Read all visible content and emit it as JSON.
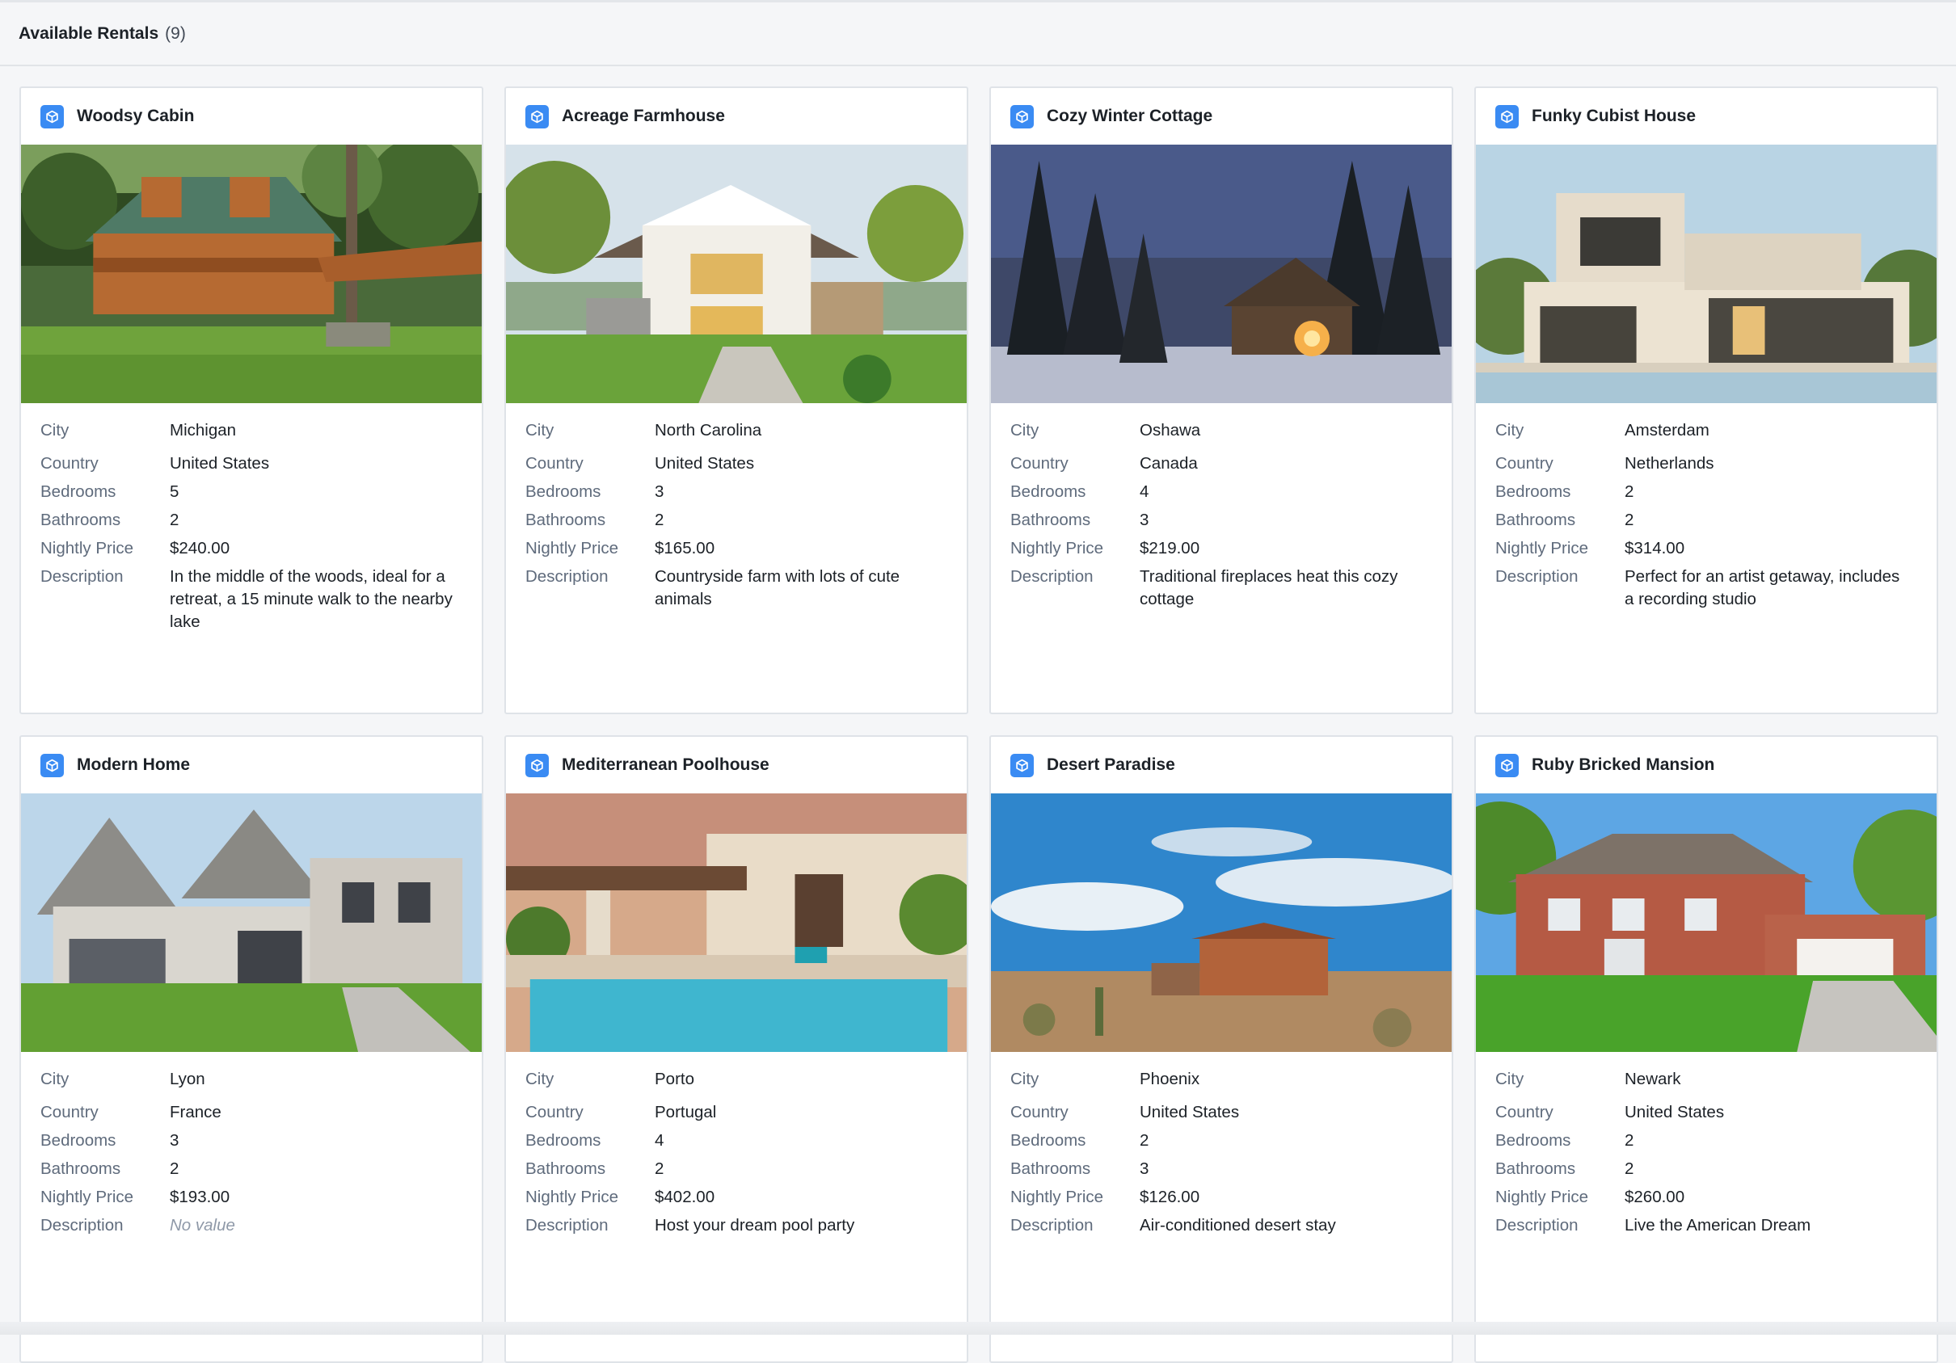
{
  "header": {
    "title": "Available Rentals",
    "count": "(9)"
  },
  "labels": {
    "city": "City",
    "country": "Country",
    "bedrooms": "Bedrooms",
    "bathrooms": "Bathrooms",
    "price": "Nightly Price",
    "description": "Description"
  },
  "icons": {
    "object": "cube-icon"
  },
  "colors": {
    "accent": "#3a8bf3",
    "label": "#5f6b7c",
    "text": "#1c2127",
    "empty": "#8f99a8"
  },
  "rentals": [
    {
      "name": "Woodsy Cabin",
      "city": "Michigan",
      "country": "United States",
      "bedrooms": "5",
      "bathrooms": "2",
      "price": "$240.00",
      "description": "In the middle of the woods, ideal for a retreat, a 15 minute walk to the nearby lake"
    },
    {
      "name": "Acreage Farmhouse",
      "city": "North Carolina",
      "country": "United States",
      "bedrooms": "3",
      "bathrooms": "2",
      "price": "$165.00",
      "description": "Countryside farm with lots of cute animals"
    },
    {
      "name": "Cozy Winter Cottage",
      "city": "Oshawa",
      "country": "Canada",
      "bedrooms": "4",
      "bathrooms": "3",
      "price": "$219.00",
      "description": "Traditional fireplaces heat this cozy cottage"
    },
    {
      "name": "Funky Cubist House",
      "city": "Amsterdam",
      "country": "Netherlands",
      "bedrooms": "2",
      "bathrooms": "2",
      "price": "$314.00",
      "description": "Perfect for an artist getaway, includes a recording studio"
    },
    {
      "name": "Modern Home",
      "city": "Lyon",
      "country": "France",
      "bedrooms": "3",
      "bathrooms": "2",
      "price": "$193.00",
      "description": "No value"
    },
    {
      "name": "Mediterranean Poolhouse",
      "city": "Porto",
      "country": "Portugal",
      "bedrooms": "4",
      "bathrooms": "2",
      "price": "$402.00",
      "description": "Host your dream pool party"
    },
    {
      "name": "Desert Paradise",
      "city": "Phoenix",
      "country": "United States",
      "bedrooms": "2",
      "bathrooms": "3",
      "price": "$126.00",
      "description": "Air-conditioned desert stay"
    },
    {
      "name": "Ruby Bricked Mansion",
      "city": "Newark",
      "country": "United States",
      "bedrooms": "2",
      "bathrooms": "2",
      "price": "$260.00",
      "description": "Live the American Dream"
    }
  ]
}
